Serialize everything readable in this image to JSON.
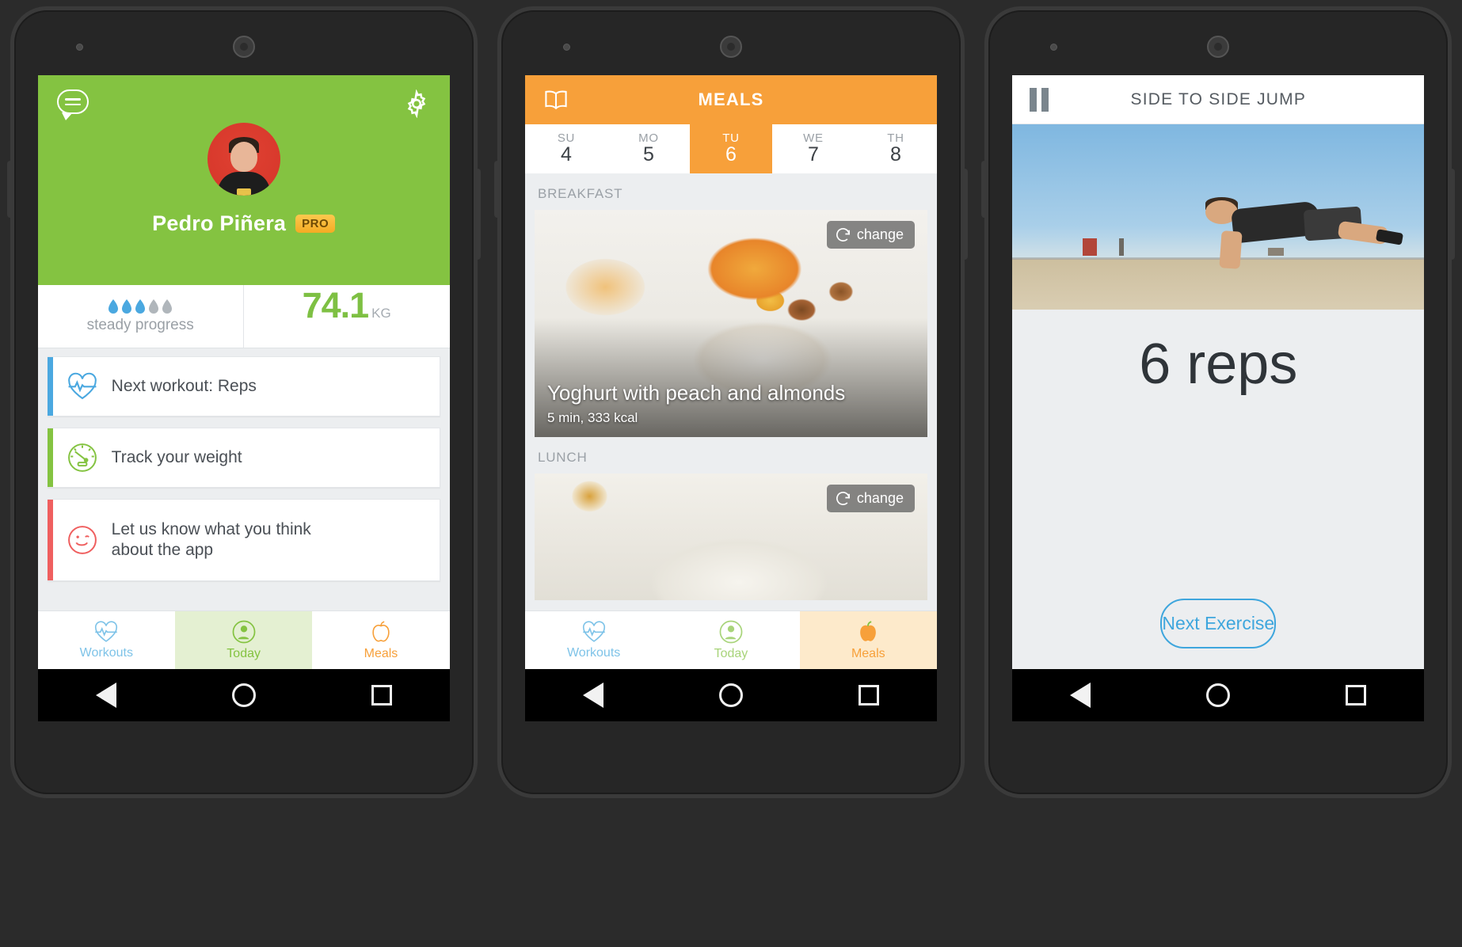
{
  "colors": {
    "green": "#84c341",
    "orange": "#f7a03a",
    "blue": "#3ea6dd",
    "red": "#ef5f5f",
    "gray_text": "#9aa0a6"
  },
  "phone1": {
    "chat_icon": "chat-bubble-icon",
    "gear_icon": "gear-icon",
    "user_name": "Pedro Piñera",
    "pro_badge": "PRO",
    "progress_label": "steady progress",
    "drops_filled": 3,
    "drops_total": 5,
    "weight_value": "74.1",
    "weight_unit": "KG",
    "cards": [
      {
        "label": "Next workout: Reps",
        "icon": "heart-pulse-icon",
        "accent": "#4aa8e0"
      },
      {
        "label": "Track your weight",
        "icon": "speedometer-icon",
        "accent": "#84c341"
      },
      {
        "label": "Let us know what you think about the app",
        "icon": "wink-face-icon",
        "accent": "#ef5f5f"
      }
    ],
    "tabs": [
      {
        "label": "Workouts",
        "icon": "heart-pulse-icon",
        "active": false
      },
      {
        "label": "Today",
        "icon": "person-icon",
        "active": true
      },
      {
        "label": "Meals",
        "icon": "apple-icon",
        "active": false
      }
    ]
  },
  "phone2": {
    "book_icon": "open-book-icon",
    "title": "MEALS",
    "days": [
      {
        "dow": "SU",
        "num": "4",
        "selected": false
      },
      {
        "dow": "MO",
        "num": "5",
        "selected": false
      },
      {
        "dow": "TU",
        "num": "6",
        "selected": true
      },
      {
        "dow": "WE",
        "num": "7",
        "selected": false
      },
      {
        "dow": "TH",
        "num": "8",
        "selected": false
      }
    ],
    "section_breakfast": "BREAKFAST",
    "section_lunch": "LUNCH",
    "breakfast": {
      "name": "Yoghurt with peach and almonds",
      "meta": "5 min, 333 kcal",
      "change_label": "change",
      "change_icon": "refresh-icon"
    },
    "lunch": {
      "change_label": "change",
      "change_icon": "refresh-icon"
    },
    "tabs": [
      {
        "label": "Workouts",
        "icon": "heart-pulse-icon",
        "active": false
      },
      {
        "label": "Today",
        "icon": "person-icon",
        "active": false
      },
      {
        "label": "Meals",
        "icon": "apple-icon",
        "active": true
      }
    ]
  },
  "phone3": {
    "pause_icon": "pause-icon",
    "title": "SIDE TO SIDE JUMP",
    "reps": "6 reps",
    "next_label": "Next Exercise"
  },
  "softnav": {
    "back": "back-triangle-icon",
    "home": "home-circle-icon",
    "recent": "recents-square-icon"
  }
}
